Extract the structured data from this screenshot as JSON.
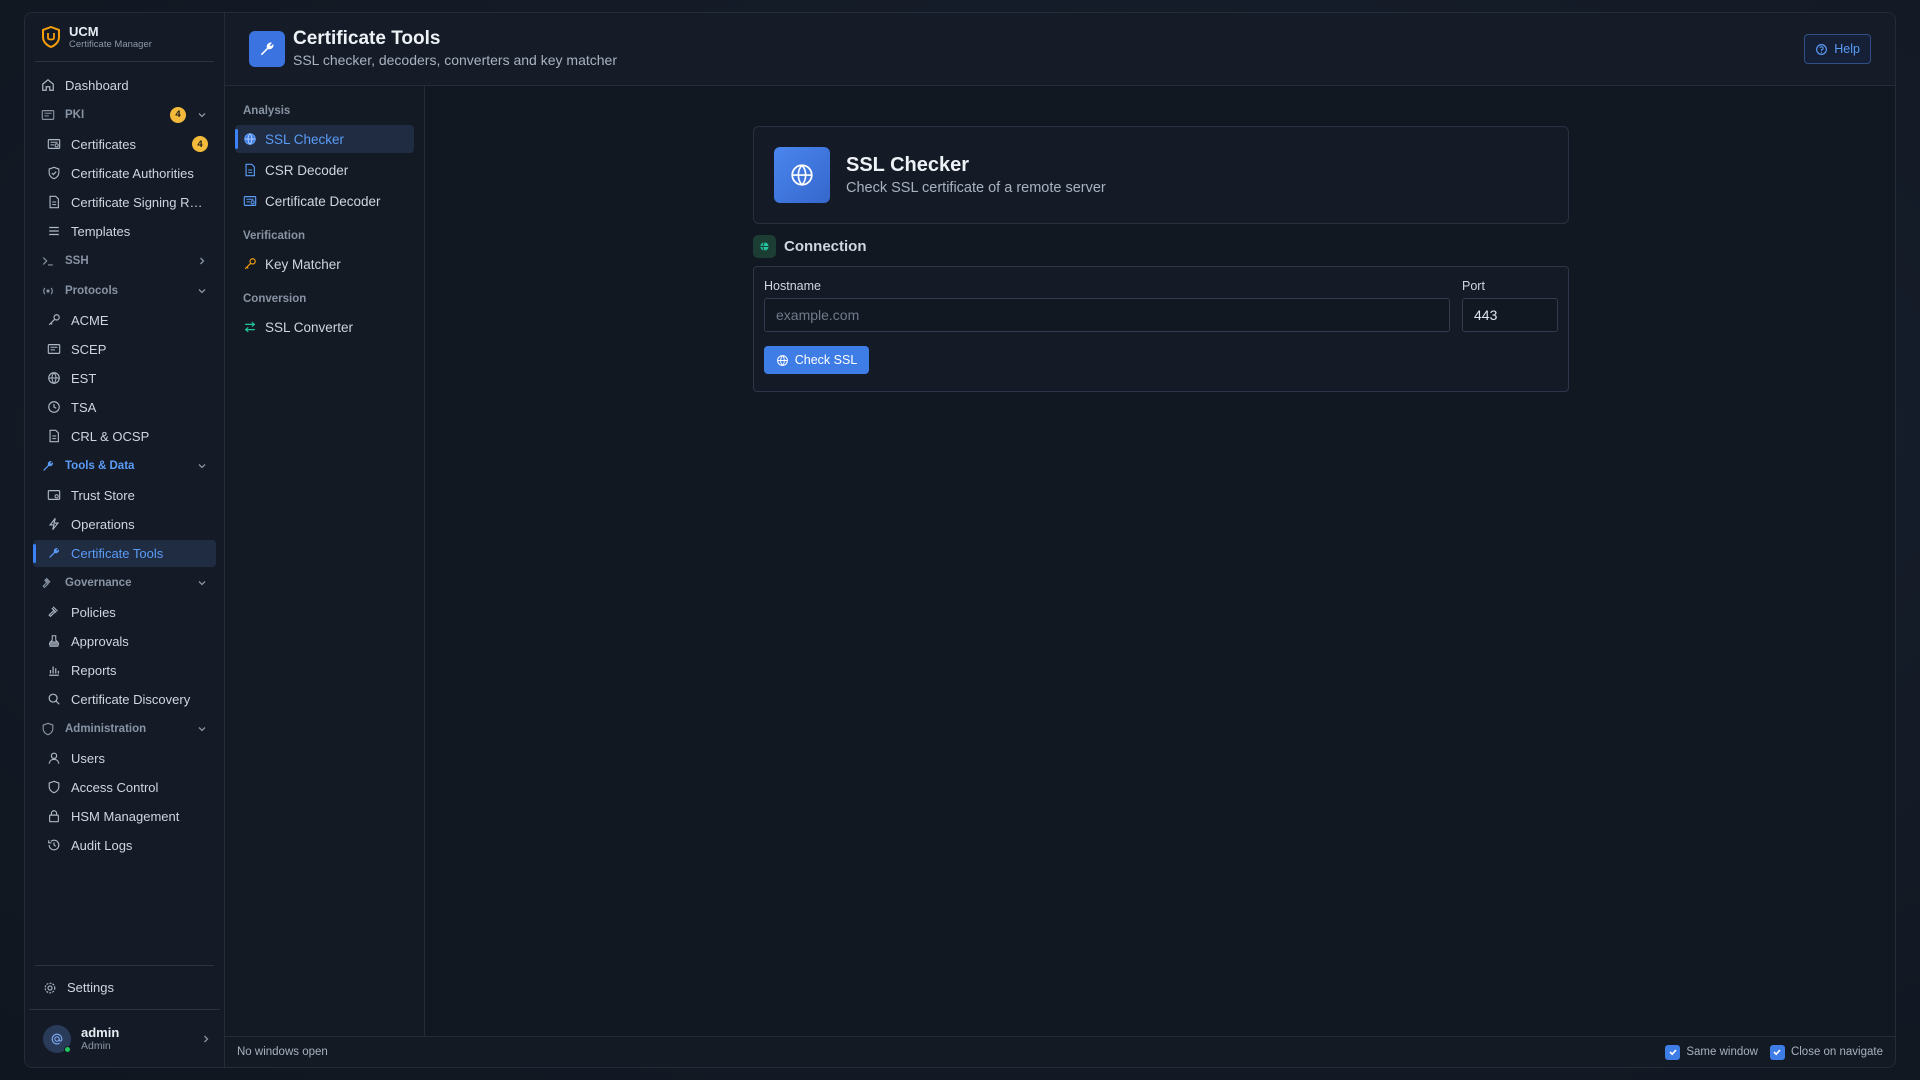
{
  "brand": {
    "title": "UCM",
    "subtitle": "Certificate Manager"
  },
  "sidebar": {
    "dashboard": "Dashboard",
    "pki": {
      "label": "PKI",
      "badge": "4",
      "items": [
        {
          "label": "Certificates",
          "badge": "4",
          "icon": "certificate-icon"
        },
        {
          "label": "Certificate Authorities",
          "icon": "shield-check-icon"
        },
        {
          "label": "Certificate Signing Requests",
          "icon": "file-icon"
        },
        {
          "label": "Templates",
          "icon": "list-icon"
        }
      ]
    },
    "ssh": {
      "label": "SSH"
    },
    "protocols": {
      "label": "Protocols",
      "items": [
        {
          "label": "ACME",
          "icon": "key-icon"
        },
        {
          "label": "SCEP",
          "icon": "certificate-icon"
        },
        {
          "label": "EST",
          "icon": "globe-icon"
        },
        {
          "label": "TSA",
          "icon": "clock-icon"
        },
        {
          "label": "CRL & OCSP",
          "icon": "file-icon"
        }
      ]
    },
    "tools": {
      "label": "Tools & Data",
      "items": [
        {
          "label": "Trust Store",
          "icon": "certificate-icon"
        },
        {
          "label": "Operations",
          "icon": "bolt-icon"
        },
        {
          "label": "Certificate Tools",
          "icon": "wrench-icon"
        }
      ]
    },
    "governance": {
      "label": "Governance",
      "items": [
        {
          "label": "Policies",
          "icon": "gavel-icon"
        },
        {
          "label": "Approvals",
          "icon": "stamp-icon"
        },
        {
          "label": "Reports",
          "icon": "bar-chart-icon"
        },
        {
          "label": "Certificate Discovery",
          "icon": "search-icon"
        }
      ]
    },
    "administration": {
      "label": "Administration",
      "items": [
        {
          "label": "Users",
          "icon": "user-icon"
        },
        {
          "label": "Access Control",
          "icon": "shield-icon"
        },
        {
          "label": "HSM Management",
          "icon": "lock-icon"
        },
        {
          "label": "Audit Logs",
          "icon": "history-icon"
        }
      ]
    },
    "settings": "Settings",
    "user": {
      "name": "admin",
      "role": "Admin"
    }
  },
  "header": {
    "title": "Certificate Tools",
    "subtitle": "SSL checker, decoders, converters and key matcher",
    "help": "Help"
  },
  "toolnav": {
    "analysis": "Analysis",
    "ssl_checker": "SSL Checker",
    "csr_decoder": "CSR Decoder",
    "cert_decoder": "Certificate Decoder",
    "verification": "Verification",
    "key_matcher": "Key Matcher",
    "conversion": "Conversion",
    "ssl_converter": "SSL Converter"
  },
  "checker": {
    "title": "SSL Checker",
    "subtitle": "Check SSL certificate of a remote server",
    "section": "Connection",
    "hostname_label": "Hostname",
    "hostname_placeholder": "example.com",
    "port_label": "Port",
    "port_value": "443",
    "button": "Check SSL"
  },
  "statusbar": {
    "left": "No windows open",
    "same_window": "Same window",
    "close_on_navigate": "Close on navigate"
  },
  "colors": {
    "accent": "#3f7de6",
    "badge": "#f2b93b",
    "background": "#121822"
  }
}
